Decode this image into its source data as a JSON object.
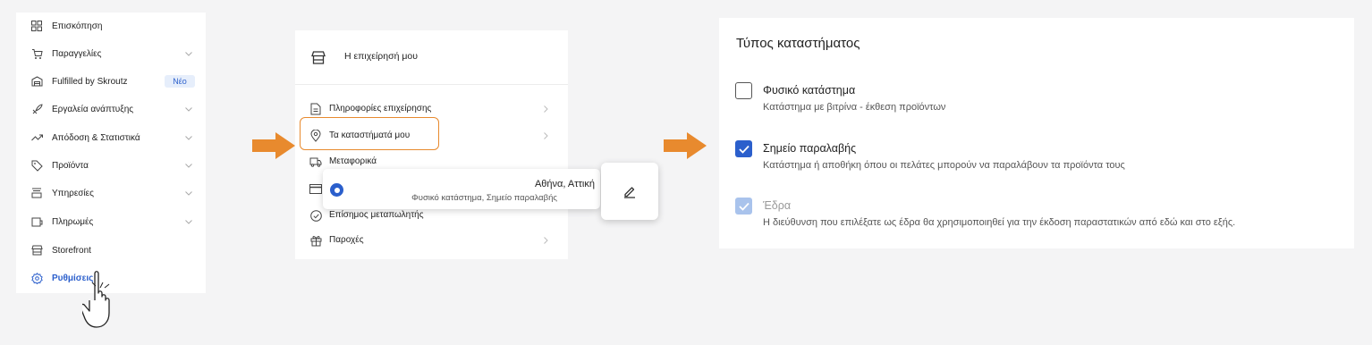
{
  "sidebar": {
    "items": [
      {
        "label": "Επισκόπηση",
        "icon": "grid-icon",
        "chevron": false
      },
      {
        "label": "Παραγγελίες",
        "icon": "cart-icon",
        "chevron": true
      },
      {
        "label": "Fulfilled by Skroutz",
        "icon": "warehouse-icon",
        "chevron": false,
        "badge": "Νέο"
      },
      {
        "label": "Εργαλεία ανάπτυξης",
        "icon": "rocket-icon",
        "chevron": true
      },
      {
        "label": "Απόδοση & Στατιστικά",
        "icon": "trend-icon",
        "chevron": true
      },
      {
        "label": "Προϊόντα",
        "icon": "tag-icon",
        "chevron": true
      },
      {
        "label": "Υπηρεσίες",
        "icon": "layers-icon",
        "chevron": true
      },
      {
        "label": "Πληρωμές",
        "icon": "wallet-icon",
        "chevron": true
      },
      {
        "label": "Storefront",
        "icon": "storefront-icon",
        "chevron": false
      },
      {
        "label": "Ρυθμίσεις",
        "icon": "settings-icon",
        "chevron": false,
        "active": true
      }
    ]
  },
  "business": {
    "title": "Η επιχείρησή μου",
    "items": [
      {
        "label": "Πληροφορίες επιχείρησης",
        "icon": "document-icon"
      },
      {
        "label": "Τα καταστήματά μου",
        "icon": "location-pin-icon"
      },
      {
        "label": "Μεταφορικά",
        "icon": "truck-icon"
      },
      {
        "label": "",
        "icon": "card-icon"
      },
      {
        "label": "Επίσημος μεταπωλητής",
        "icon": "check-circle-icon"
      },
      {
        "label": "Παροχές",
        "icon": "gift-icon"
      }
    ]
  },
  "popup": {
    "city": "Αθήνα, Αττική",
    "types": "Φυσικό κατάστημα, Σημείο παραλαβής"
  },
  "storetype": {
    "title": "Τύπος καταστήματος",
    "options": [
      {
        "title": "Φυσικό κατάστημα",
        "desc": "Κατάστημα με βιτρίνα - έκθεση προϊόντων",
        "state": "unchecked"
      },
      {
        "title": "Σημείο παραλαβής",
        "desc": "Κατάστημα ή αποθήκη όπου οι πελάτες μπορούν να παραλάβουν τα προϊόντα τους",
        "state": "checked"
      },
      {
        "title": "Έδρα",
        "desc": "Η διεύθυνση που επιλέξατε ως έδρα θα χρησιμοποιηθεί για την έκδοση παραστατικών από εδώ και στο εξής.",
        "state": "disabled"
      }
    ]
  },
  "colors": {
    "accent": "#2b5fcc",
    "highlight": "#e88a2e",
    "arrow": "#e88a2e",
    "background": "#f4f4f5"
  }
}
